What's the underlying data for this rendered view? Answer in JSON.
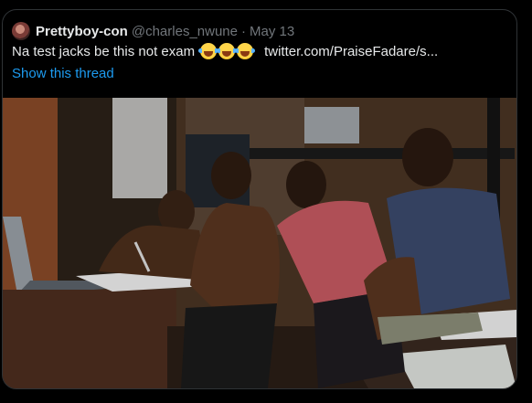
{
  "tweet": {
    "display_name": "Prettyboy-con",
    "handle": "@charles_nwune",
    "separator": "·",
    "date": "May 13",
    "text": "Na test jacks be this not exam",
    "emojis": [
      "face-with-tears-of-joy",
      "face-with-tears-of-joy",
      "face-with-tears-of-joy"
    ],
    "link": "twitter.com/PraiseFadare/s...",
    "show_thread_label": "Show this thread"
  },
  "colors": {
    "background": "#000000",
    "primary_text": "#e7e9ea",
    "secondary_text": "#71767b",
    "accent": "#1d9bf0",
    "border": "#2f3336"
  }
}
